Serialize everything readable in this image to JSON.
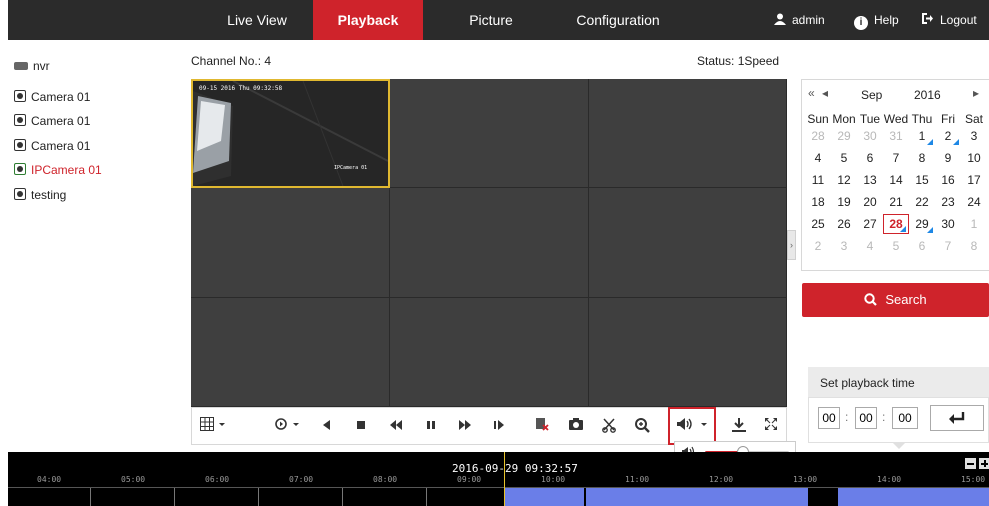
{
  "nav": {
    "tabs": [
      "Live View",
      "Playback",
      "Picture",
      "Configuration"
    ],
    "active": "Playback",
    "user": "admin",
    "help": "Help",
    "logout": "Logout"
  },
  "tree": {
    "root": "nvr",
    "items": [
      "Camera 01",
      "Camera 01",
      "Camera 01",
      "IPCamera 01",
      "testing"
    ],
    "active_index": 3
  },
  "header": {
    "channel": "Channel No.: 4",
    "status": "Status: 1Speed"
  },
  "video": {
    "osd_time": "09-15 2016 Thu 09:32:58",
    "osd_name": "IPCamera 01"
  },
  "calendar": {
    "nav_prev_year": "«",
    "nav_prev_month": "◂",
    "nav_next": "▸",
    "month": "Sep",
    "year": "2016",
    "weekdays": [
      "Sun",
      "Mon",
      "Tue",
      "Wed",
      "Thu",
      "Fri",
      "Sat"
    ],
    "rows": [
      [
        "28",
        "29",
        "30",
        "31",
        "1",
        "2",
        "3"
      ],
      [
        "4",
        "5",
        "6",
        "7",
        "8",
        "9",
        "10"
      ],
      [
        "11",
        "12",
        "13",
        "14",
        "15",
        "16",
        "17"
      ],
      [
        "18",
        "19",
        "20",
        "21",
        "22",
        "23",
        "24"
      ],
      [
        "25",
        "26",
        "27",
        "28",
        "29",
        "30",
        "1"
      ],
      [
        "2",
        "3",
        "4",
        "5",
        "6",
        "7",
        "8"
      ]
    ],
    "selected": "28",
    "recorded_days": [
      "1",
      "2",
      "28",
      "29"
    ]
  },
  "search": {
    "label": "Search"
  },
  "playback_time": {
    "title": "Set playback time",
    "h": "00",
    "m": "00",
    "s": "00",
    "sep": ":"
  },
  "volume": {
    "level": 0.45
  },
  "timeline": {
    "current": "2016-09-29 09:32:57",
    "labels": [
      "04:00",
      "05:00",
      "06:00",
      "07:00",
      "08:00",
      "09:00",
      "10:00",
      "11:00",
      "12:00",
      "13:00",
      "14:00",
      "15:00"
    ]
  },
  "colors": {
    "accent": "#cf232b",
    "nav_bg": "#2b2b2b",
    "record_bar": "#6a7ee8",
    "record_marker": "#1e88e5"
  }
}
